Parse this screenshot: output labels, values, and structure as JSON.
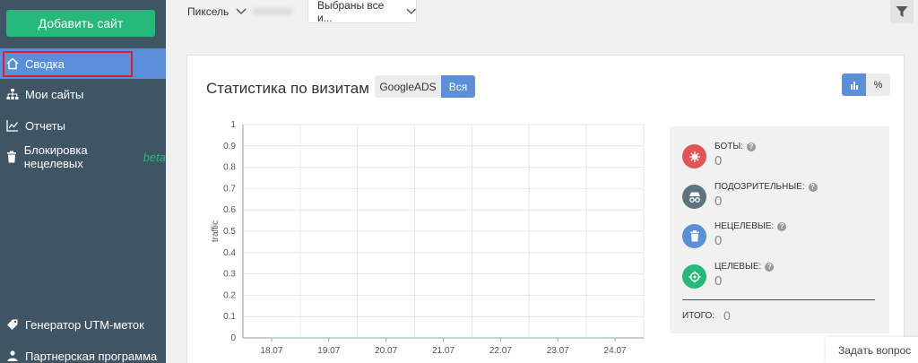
{
  "sidebar": {
    "add_site": "Добавить сайт",
    "items": [
      {
        "label": "Сводка",
        "icon": "home-icon"
      },
      {
        "label": "Мои сайты",
        "icon": "sitemap-icon"
      },
      {
        "label": "Отчеты",
        "icon": "line-chart-icon"
      },
      {
        "label": "Блокировка нецелевых",
        "beta": "beta",
        "icon": "trash-icon"
      },
      {
        "label": "Генератор UTM-меток",
        "icon": "tag-icon"
      },
      {
        "label": "Партнерская программа",
        "icon": "users-icon"
      }
    ]
  },
  "topbar": {
    "pixel_label": "Пиксель",
    "selected_label": "Выбраны все и..."
  },
  "card": {
    "title": "Статистика по визитам",
    "source_tabs": [
      "GoogleADS",
      "Вся"
    ],
    "view_pct": "%"
  },
  "chart_data": {
    "type": "line",
    "ylabel": "traffic",
    "ylim": [
      0,
      1
    ],
    "yticks": [
      "0",
      "0.1",
      "0.2",
      "0.3",
      "0.4",
      "0.5",
      "0.6",
      "0.7",
      "0.8",
      "0.9",
      "1"
    ],
    "categories": [
      "18.07",
      "19.07",
      "20.07",
      "21.07",
      "22.07",
      "23.07",
      "24.07"
    ],
    "series": [
      {
        "values": [
          0,
          0,
          0,
          0,
          0,
          0,
          0
        ]
      }
    ]
  },
  "stats": {
    "bots": {
      "label": "БОТЫ:",
      "value": "0"
    },
    "suspicious": {
      "label": "ПОДОЗРИТЕЛЬНЫЕ:",
      "value": "0"
    },
    "untargeted": {
      "label": "НЕЦЕЛЕВЫЕ:",
      "value": "0"
    },
    "targeted": {
      "label": "ЦЕЛЕВЫЕ:",
      "value": "0"
    },
    "total": {
      "label": "ИТОГО:",
      "value": "0"
    }
  },
  "colors": {
    "sidebar": "#405563",
    "accent": "#5b8fd9",
    "green": "#25b97c",
    "bots": "#e35454",
    "suspicious": "#5d7380",
    "untargeted": "#5b8fd9",
    "targeted": "#25b97c"
  },
  "help": {
    "ask": "Задать вопрос"
  }
}
